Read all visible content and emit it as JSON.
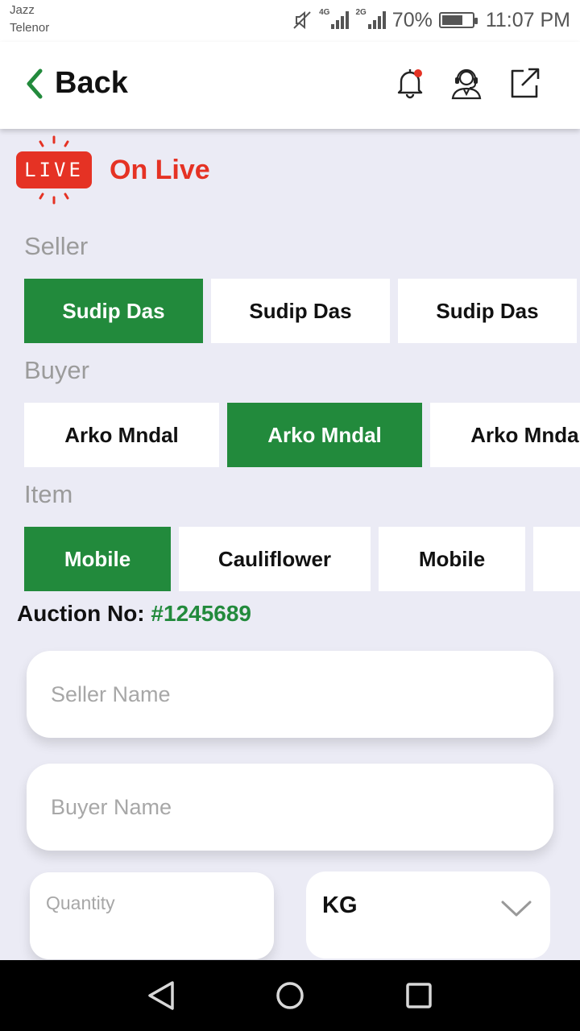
{
  "status_bar": {
    "carrier_1": "Jazz",
    "carrier_2": "Telenor",
    "net_1": "4G",
    "net_2": "2G",
    "battery": "70%",
    "battery_level": 0.7,
    "time": "11:07 PM",
    "icons": [
      "mute-icon",
      "signal-icon",
      "signal-icon",
      "battery-icon"
    ]
  },
  "header": {
    "back_label": "Back",
    "icons": [
      "bell-icon",
      "support-agent-icon",
      "external-link-icon"
    ],
    "notification_dot_color": "#e53224"
  },
  "live": {
    "badge_text": "LIVE",
    "label": "On Live",
    "color": "#e53224"
  },
  "seller": {
    "label": "Seller",
    "chips": [
      {
        "label": "Sudip Das",
        "selected": true
      },
      {
        "label": "Sudip Das",
        "selected": false
      },
      {
        "label": "Sudip Das",
        "selected": false
      }
    ]
  },
  "buyer": {
    "label": "Buyer",
    "chips": [
      {
        "label": "Arko Mndal",
        "selected": false
      },
      {
        "label": "Arko Mndal",
        "selected": true
      },
      {
        "label": "Arko Mndal",
        "selected": false
      }
    ]
  },
  "item": {
    "label": "Item",
    "chips": [
      {
        "label": "Mobile",
        "selected": true
      },
      {
        "label": "Cauliflower",
        "selected": false
      },
      {
        "label": "Mobile",
        "selected": false
      },
      {
        "label": "",
        "selected": false
      }
    ]
  },
  "auction": {
    "label": "Auction No:",
    "number": "#1245689"
  },
  "form": {
    "seller_placeholder": "Seller Name",
    "buyer_placeholder": "Buyer Name",
    "quantity_placeholder": "Quantity",
    "unit_value": "KG"
  },
  "colors": {
    "accent_green": "#228a3c",
    "live_red": "#e53224",
    "background": "#ebebf5"
  }
}
